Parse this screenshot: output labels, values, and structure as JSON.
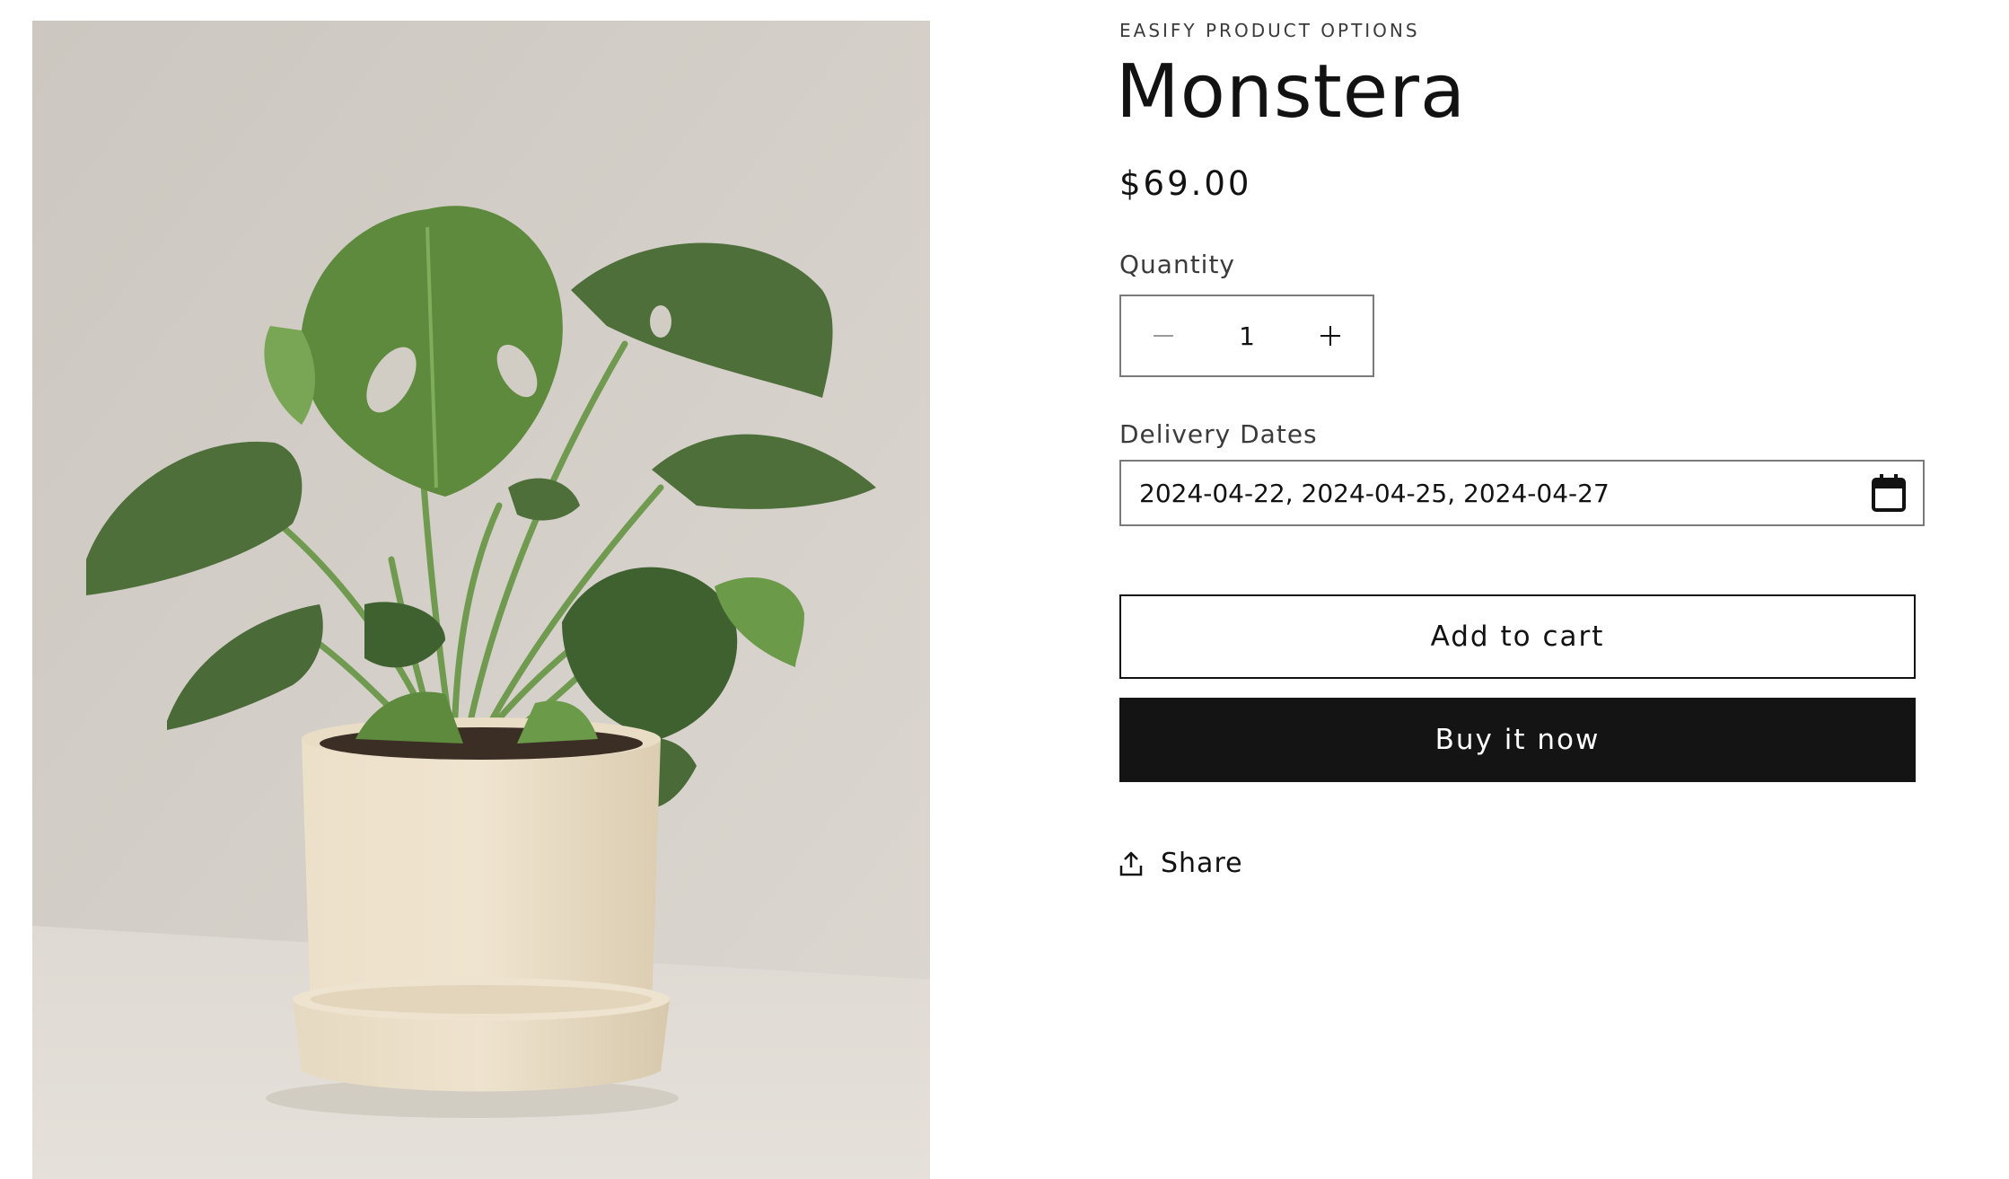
{
  "product": {
    "vendor": "EASIFY PRODUCT OPTIONS",
    "title": "Monstera",
    "price": "$69.00",
    "image_subject": "monstera plant in cream pot"
  },
  "quantity": {
    "label": "Quantity",
    "value": "1",
    "decrease_icon": "minus-icon",
    "increase_icon": "plus-icon"
  },
  "delivery": {
    "label": "Delivery Dates",
    "value": "2024-04-22, 2024-04-25, 2024-04-27",
    "icon": "calendar-icon"
  },
  "actions": {
    "add_to_cart": "Add to cart",
    "buy_now": "Buy it now",
    "share": "Share",
    "share_icon": "share-icon"
  },
  "colors": {
    "primary_text": "#121212",
    "buy_button_bg": "#141414",
    "border": "#7a7a7a",
    "image_background": "#d3cfc8"
  }
}
